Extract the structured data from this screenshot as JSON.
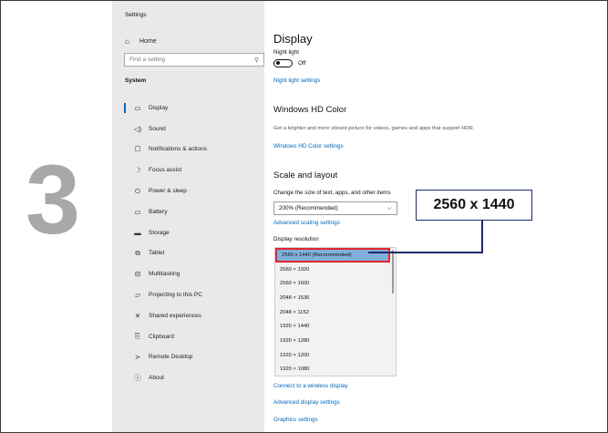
{
  "step_number": "3",
  "window": {
    "title": "Settings"
  },
  "sidebar": {
    "home_label": "Home",
    "search_placeholder": "Find a setting",
    "section": "System",
    "items": [
      {
        "label": "Display",
        "icon": "monitor-icon",
        "active": true
      },
      {
        "label": "Sound",
        "icon": "speaker-icon"
      },
      {
        "label": "Notifications & actions",
        "icon": "notification-icon"
      },
      {
        "label": "Focus assist",
        "icon": "moon-icon"
      },
      {
        "label": "Power & sleep",
        "icon": "power-icon"
      },
      {
        "label": "Battery",
        "icon": "battery-icon"
      },
      {
        "label": "Storage",
        "icon": "storage-icon"
      },
      {
        "label": "Tablet",
        "icon": "tablet-icon"
      },
      {
        "label": "Multitasking",
        "icon": "multitasking-icon"
      },
      {
        "label": "Projecting to this PC",
        "icon": "projector-icon"
      },
      {
        "label": "Shared experiences",
        "icon": "shared-icon"
      },
      {
        "label": "Clipboard",
        "icon": "clipboard-icon"
      },
      {
        "label": "Remote Desktop",
        "icon": "remote-icon"
      },
      {
        "label": "About",
        "icon": "info-icon"
      }
    ]
  },
  "content": {
    "title": "Display",
    "night_light_label": "Night light",
    "night_light_state": "Off",
    "night_light_settings_link": "Night light settings",
    "hdr_heading": "Windows HD Color",
    "hdr_desc": "Get a brighter and more vibrant picture for videos, games and apps that support HDR.",
    "hdr_link": "Windows HD Color settings",
    "scale_heading": "Scale and layout",
    "scale_label": "Change the size of text, apps, and other items",
    "scale_value": "200% (Recommended)",
    "advanced_scaling_link": "Advanced scaling settings",
    "resolution_label": "Display resolution",
    "resolutions": [
      "2560 x 1440  (Recommended)",
      "2560 × 1920",
      "2560 × 1600",
      "2048 × 1536",
      "2048 × 1152",
      "1920 × 1440",
      "1920 × 1280",
      "1920 × 1200",
      "1920 × 1080"
    ],
    "selected_resolution_index": 0,
    "wireless_link": "Connect to a wireless display",
    "advanced_display_link": "Advanced display settings",
    "graphics_link": "Graphics settings"
  },
  "callout": {
    "text": "2560 x 1440",
    "border_color": "#1f2a6e"
  },
  "colors": {
    "accent": "#0067b8",
    "selection": "#7fb0db",
    "highlight_border": "#e3262e",
    "step_number": "#a8a8a8"
  }
}
